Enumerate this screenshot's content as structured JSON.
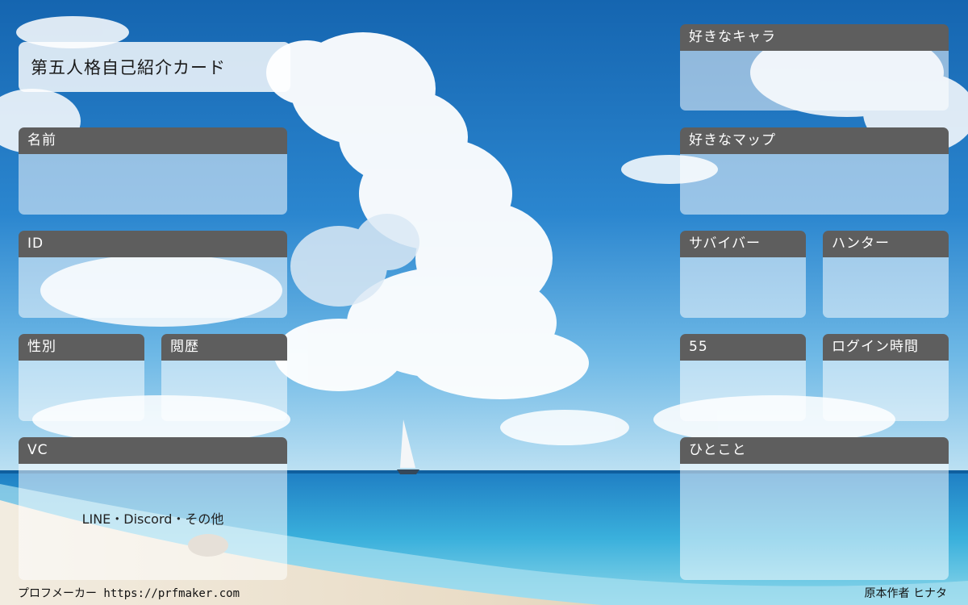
{
  "title": "第五人格自己紹介カード",
  "fields": {
    "name": {
      "label": "名前"
    },
    "id": {
      "label": "ID"
    },
    "gender": {
      "label": "性別"
    },
    "history": {
      "label": "閲歴"
    },
    "vc": {
      "label": "VC",
      "options": "LINE・Discord・その他"
    },
    "fav_character": {
      "label": "好きなキャラ"
    },
    "fav_map": {
      "label": "好きなマップ"
    },
    "survivor": {
      "label": "サバイバー"
    },
    "hunter": {
      "label": "ハンター"
    },
    "ss": {
      "label": "55"
    },
    "login_time": {
      "label": "ログイン時間"
    },
    "comment": {
      "label": "ひとこと"
    }
  },
  "footer": {
    "maker": "プロフメーカー https://prfmaker.com",
    "author": "原本作者 ヒナタ"
  }
}
